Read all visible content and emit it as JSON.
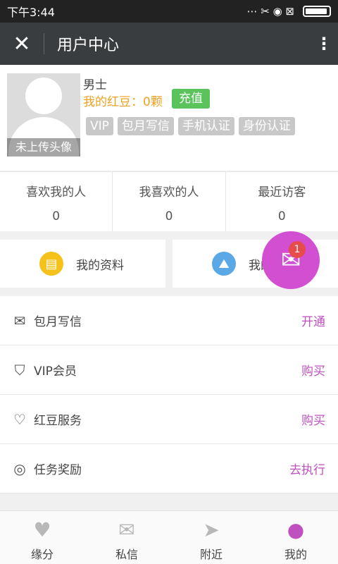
{
  "status": {
    "time": "下午3:44",
    "icons": "⋯ ✂ ◉ ⊠"
  },
  "header": {
    "close_glyph": "✕",
    "title": "用户中心",
    "menu_glyph": "⋮"
  },
  "profile": {
    "avatar_label": "未上传头像",
    "gender": "男士",
    "beans": "我的红豆：0颗",
    "recharge_label": "充值",
    "tags": [
      "VIP",
      "包月写信",
      "手机认证",
      "身份认证"
    ]
  },
  "stats": [
    {
      "label": "喜欢我的人",
      "value": "0"
    },
    {
      "label": "我喜欢的人",
      "value": "0"
    },
    {
      "label": "最近访客",
      "value": "0"
    }
  ],
  "cards": [
    {
      "label": "我的资料",
      "icon": "document-icon",
      "color": "#f5c21b"
    },
    {
      "label": "我的",
      "icon": "photo-icon",
      "color": "#5aa9e6"
    }
  ],
  "list": [
    {
      "label": "包月写信",
      "action": "开通",
      "icon": "envelope-icon"
    },
    {
      "label": "VIP会员",
      "action": "购买",
      "icon": "shield-icon"
    },
    {
      "label": "红豆服务",
      "action": "购买",
      "icon": "heart-icon"
    },
    {
      "label": "任务奖励",
      "action": "去执行",
      "icon": "coins-icon"
    }
  ],
  "fab": {
    "badge": "1",
    "icon": "mail-icon"
  },
  "tabs": [
    {
      "label": "缘分",
      "icon": "heart-icon"
    },
    {
      "label": "私信",
      "icon": "envelope-icon"
    },
    {
      "label": "附近",
      "icon": "paper-plane-icon"
    },
    {
      "label": "我的",
      "icon": "person-icon",
      "active": true
    }
  ],
  "colors": {
    "accent": "#c050c0",
    "fab": "#d24fd2",
    "recharge": "#5bc35b",
    "beans": "#f0a020"
  }
}
